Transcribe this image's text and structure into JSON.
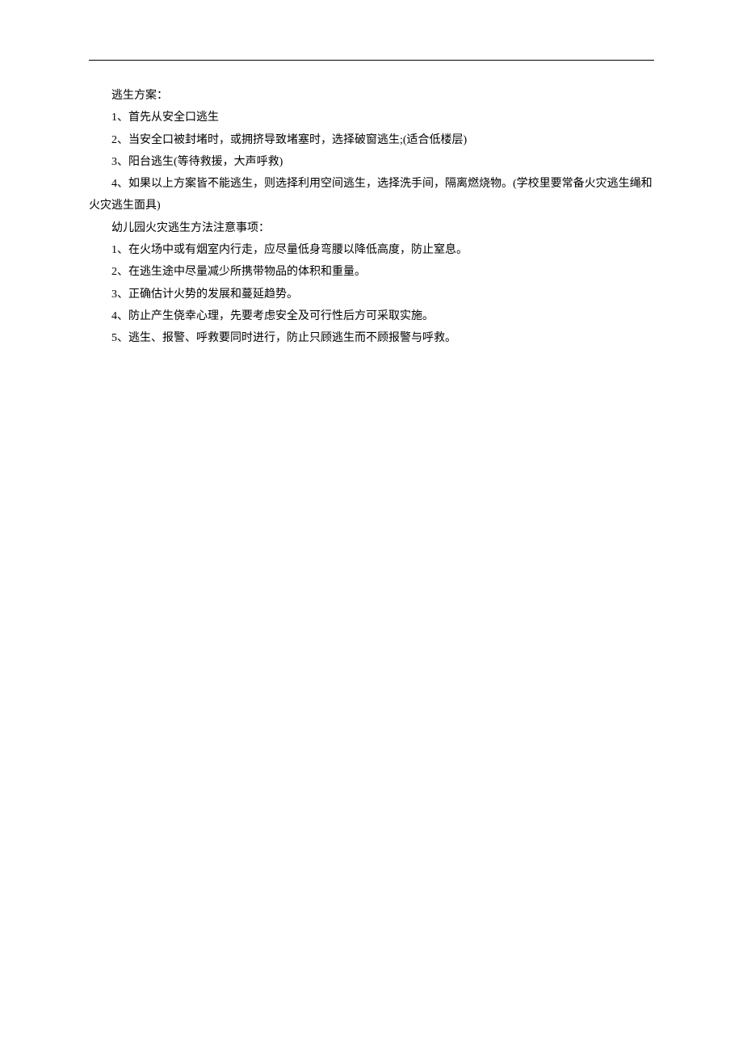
{
  "section1": {
    "heading": "逃生方案：",
    "items": [
      {
        "num": "1、",
        "text": "首先从安全口逃生"
      },
      {
        "num": "2、",
        "text": "当安全口被封堵时，或拥挤导致堵塞时，选择破窗逃生;(适合低楼层)"
      },
      {
        "num": "3、",
        "text": "阳台逃生(等待救援，大声呼救)"
      },
      {
        "num": "4、",
        "text": "如果以上方案皆不能逃生，则选择利用空间逃生，选择洗手间，隔离燃烧物。(学校里要常备火灾逃生绳和火灾逃生面具)"
      }
    ]
  },
  "section2": {
    "heading": "幼儿园火灾逃生方法注意事项：",
    "items": [
      {
        "num": "1、",
        "text": "在火场中或有烟室内行走，应尽量低身弯腰以降低高度，防止窒息。"
      },
      {
        "num": "2、",
        "text": "在逃生途中尽量减少所携带物品的体积和重量。"
      },
      {
        "num": "3、",
        "text": "正确估计火势的发展和蔓延趋势。"
      },
      {
        "num": "4、",
        "text": "防止产生侥幸心理，先要考虑安全及可行性后方可采取实施。"
      },
      {
        "num": "5、",
        "text": "逃生、报警、呼救要同时进行，防止只顾逃生而不顾报警与呼救。"
      }
    ]
  }
}
